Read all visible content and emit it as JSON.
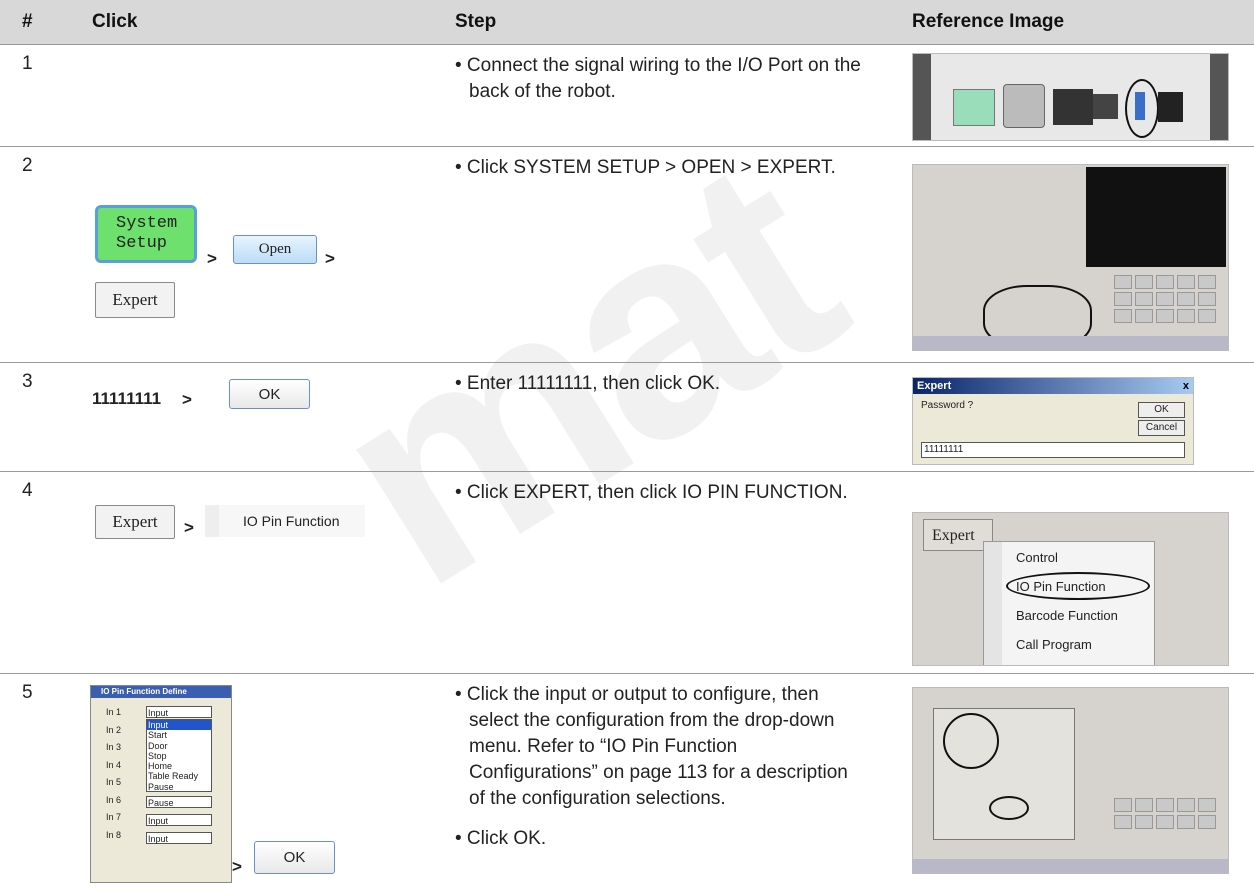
{
  "watermark": "mat",
  "header": {
    "num": "#",
    "click": "Click",
    "step": "Step",
    "ref": "Reference Image"
  },
  "rows": [
    {
      "num": "1",
      "steps": [
        "• Connect the signal wiring to the I/O Port on the back of the robot."
      ]
    },
    {
      "num": "2",
      "steps": [
        "• Click SYSTEM SETUP > OPEN > EXPERT."
      ],
      "system_setup_1": "System",
      "system_setup_2": "Setup",
      "open": "Open",
      "expert": "Expert",
      "gt": ">"
    },
    {
      "num": "3",
      "steps": [
        "• Enter 11111111, then click OK."
      ],
      "code": "11111111",
      "gt": ">",
      "ok": "OK",
      "dialog": {
        "title": "Expert",
        "close": "x",
        "label": "Password ?",
        "ok": "OK",
        "cancel": "Cancel",
        "value": "11111111"
      }
    },
    {
      "num": "4",
      "steps": [
        "• Click EXPERT, then click IO PIN FUNCTION."
      ],
      "expert": "Expert",
      "gt": ">",
      "io_pin": "IO Pin Function",
      "menu": {
        "expert": "Expert",
        "items": [
          "Control",
          "IO Pin Function",
          "Barcode Function",
          "Call Program"
        ]
      }
    },
    {
      "num": "5",
      "steps": [
        "• Click the input or output to configure, then select the configuration from the drop-down menu. Refer to “IO Pin Function Configurations” on page 113 for a description of the configuration selections.",
        "• Click OK."
      ],
      "gt": ">",
      "ok": "OK",
      "io_dialog": {
        "title": "IO Pin Function Define",
        "pins": [
          {
            "label": "In 1",
            "value": "Input"
          },
          {
            "label": "In 2",
            "value": ""
          },
          {
            "label": "In 3",
            "value": ""
          },
          {
            "label": "In 4",
            "value": ""
          },
          {
            "label": "In 5",
            "value": ""
          },
          {
            "label": "In 6",
            "value": "Pause"
          },
          {
            "label": "In 7",
            "value": "Input"
          },
          {
            "label": "In 8",
            "value": "Input"
          }
        ],
        "options": [
          "Input",
          "Start",
          "Door",
          "Stop",
          "Home",
          "Table Ready",
          "Pause"
        ]
      }
    }
  ]
}
